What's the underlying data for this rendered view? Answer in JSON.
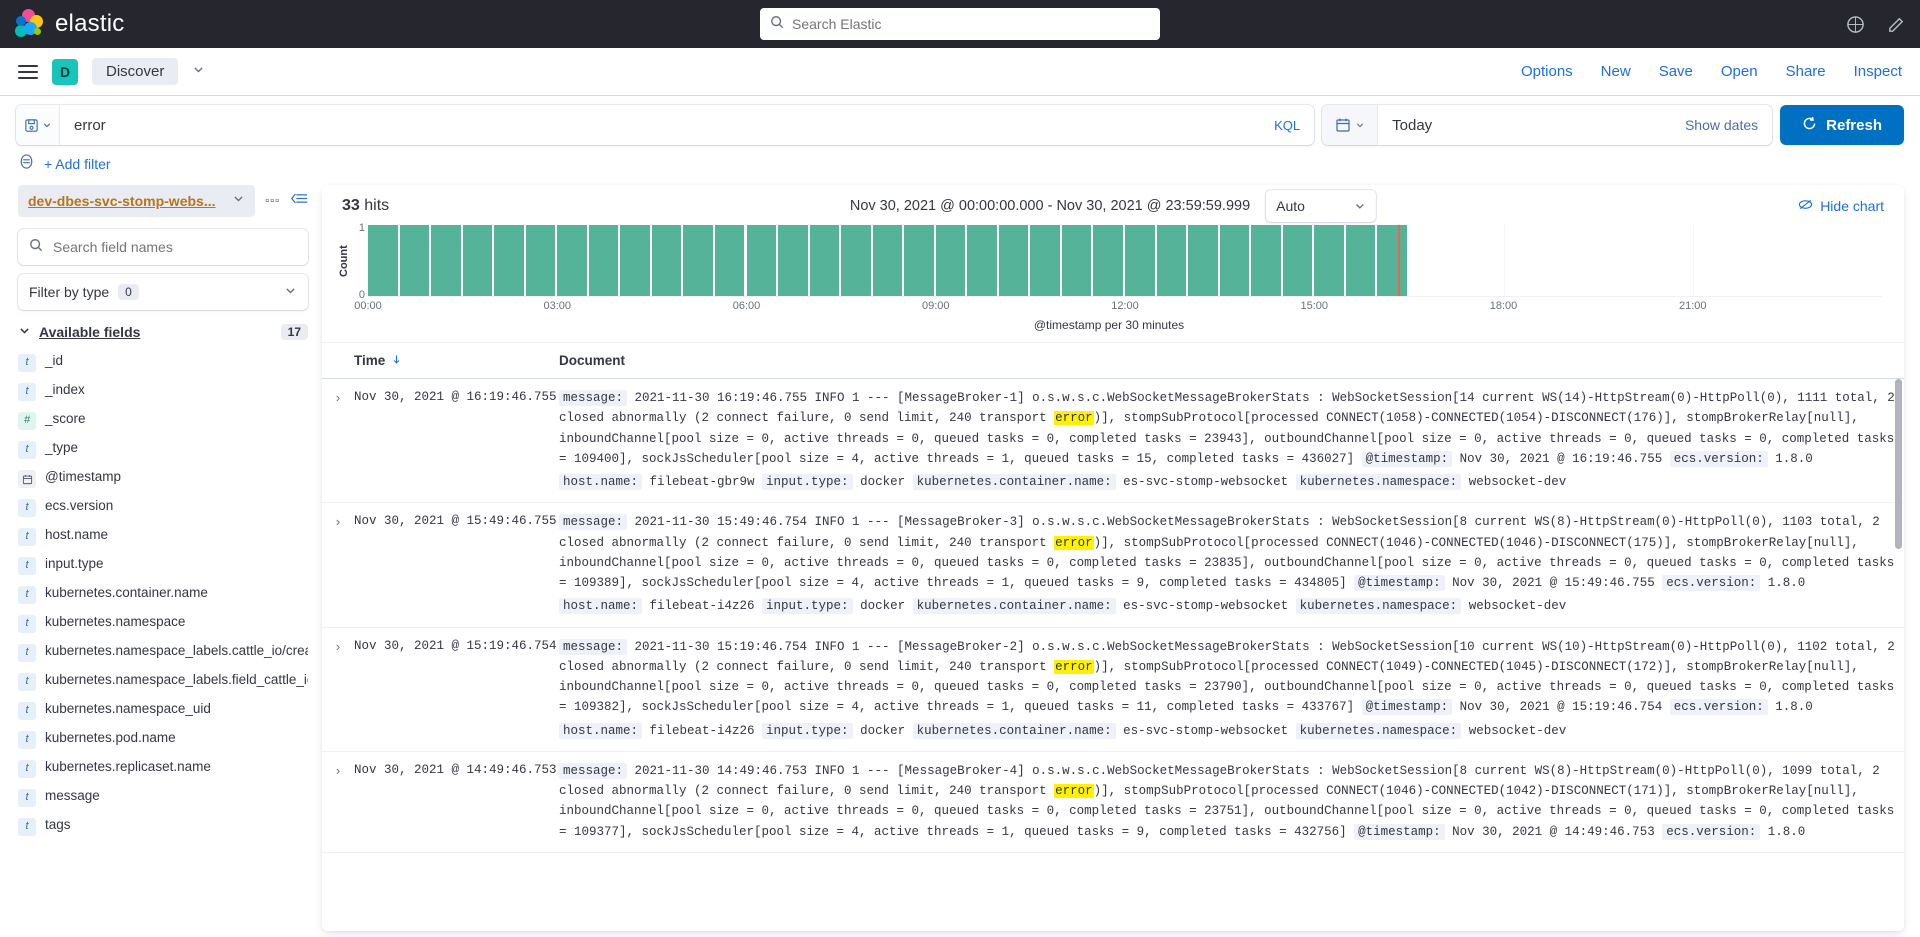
{
  "header": {
    "brand": "elastic",
    "search_placeholder": "Search Elastic",
    "icons": {
      "help": "help-icon",
      "feedback": "feedback-icon"
    }
  },
  "app_nav": {
    "menu_icon": "hamburger-menu-icon",
    "space_initial": "D",
    "breadcrumb": "Discover",
    "links": [
      "Options",
      "New",
      "Save",
      "Open",
      "Share",
      "Inspect"
    ]
  },
  "query_bar": {
    "saved_query_icon": "save-floppy-icon",
    "query": "error",
    "language": "KQL",
    "calendar_icon": "calendar-icon",
    "date_value": "Today",
    "show_dates": "Show dates",
    "refresh_label": "Refresh",
    "refresh_icon": "refresh-icon"
  },
  "filter_bar": {
    "filter_icon": "filter-icon",
    "add_filter": "+ Add filter"
  },
  "sidebar": {
    "index_pattern": "dev-dbes-svc-stomp-webs...",
    "search_placeholder": "Search field names",
    "filter_by_type": "Filter by type",
    "filter_count": "0",
    "available_fields_label": "Available fields",
    "available_fields_count": "17",
    "fields": [
      {
        "name": "_id",
        "type": "str"
      },
      {
        "name": "_index",
        "type": "str"
      },
      {
        "name": "_score",
        "type": "num"
      },
      {
        "name": "_type",
        "type": "str"
      },
      {
        "name": "@timestamp",
        "type": "date"
      },
      {
        "name": "ecs.version",
        "type": "str"
      },
      {
        "name": "host.name",
        "type": "str"
      },
      {
        "name": "input.type",
        "type": "str"
      },
      {
        "name": "kubernetes.container.name",
        "type": "str"
      },
      {
        "name": "kubernetes.namespace",
        "type": "str"
      },
      {
        "name": "kubernetes.namespace_labels.cattle_io/creator",
        "type": "str"
      },
      {
        "name": "kubernetes.namespace_labels.field_cattle_io/projectId",
        "type": "str"
      },
      {
        "name": "kubernetes.namespace_uid",
        "type": "str"
      },
      {
        "name": "kubernetes.pod.name",
        "type": "str"
      },
      {
        "name": "kubernetes.replicaset.name",
        "type": "str"
      },
      {
        "name": "message",
        "type": "str"
      },
      {
        "name": "tags",
        "type": "str"
      }
    ]
  },
  "main": {
    "hits_count": "33",
    "hits_label": "hits",
    "time_range": "Nov 30, 2021 @ 00:00:00.000 - Nov 30, 2021 @ 23:59:59.999",
    "interval": "Auto",
    "hide_chart": "Hide chart",
    "columns": {
      "time": "Time",
      "document": "Document",
      "sort_icon": "sort-desc-icon"
    }
  },
  "chart_data": {
    "type": "bar",
    "title": "",
    "xlabel": "@timestamp per 30 minutes",
    "ylabel": "Count",
    "ylim": [
      0,
      1
    ],
    "ytick_labels": [
      "0",
      "1"
    ],
    "xtick_labels": [
      "00:00",
      "03:00",
      "06:00",
      "09:00",
      "12:00",
      "15:00",
      "18:00",
      "21:00"
    ],
    "bar_color": "#54b399",
    "now_marker_color": "#e7664c",
    "now_marker_time": "16:20",
    "grid": true,
    "legend": "none",
    "bin_minutes": 30,
    "categories": [
      "00:00",
      "00:30",
      "01:00",
      "01:30",
      "02:00",
      "02:30",
      "03:00",
      "03:30",
      "04:00",
      "04:30",
      "05:00",
      "05:30",
      "06:00",
      "06:30",
      "07:00",
      "07:30",
      "08:00",
      "08:30",
      "09:00",
      "09:30",
      "10:00",
      "10:30",
      "11:00",
      "11:30",
      "12:00",
      "12:30",
      "13:00",
      "13:30",
      "14:00",
      "14:30",
      "15:00",
      "15:30",
      "16:00",
      "16:30",
      "17:00",
      "17:30",
      "18:00",
      "18:30",
      "19:00",
      "19:30",
      "20:00",
      "20:30",
      "21:00",
      "21:30",
      "22:00",
      "22:30",
      "23:00",
      "23:30"
    ],
    "values": [
      1,
      1,
      1,
      1,
      1,
      1,
      1,
      1,
      1,
      1,
      1,
      1,
      1,
      1,
      1,
      1,
      1,
      1,
      1,
      1,
      1,
      1,
      1,
      1,
      1,
      1,
      1,
      1,
      1,
      1,
      1,
      1,
      1,
      0,
      0,
      0,
      0,
      0,
      0,
      0,
      0,
      0,
      0,
      0,
      0,
      0,
      0,
      0
    ]
  },
  "documents": [
    {
      "time": "Nov 30, 2021 @ 16:19:46.755",
      "segments": [
        {
          "k": "message:"
        },
        {
          "t": " 2021-11-30 16:19:46.755 INFO 1 --- [MessageBroker-1] o.s.w.s.c.WebSocketMessageBrokerStats : WebSocketSession[14 current WS(14)-HttpStream(0)-HttpPoll(0), 1111 total, 2 closed abnormally (2 connect failure, 0 send limit, 240 transport "
        },
        {
          "hl": "error"
        },
        {
          "t": ")], stompSubProtocol[processed CONNECT(1058)-CONNECTED(1054)-DISCONNECT(176)], stompBrokerRelay[null], inboundChannel[pool size = 0, active threads = 0, queued tasks = 0, completed tasks = 23943], outboundChannel[pool size = 0, active threads = 0, queued tasks = 0, completed tasks = 109400], sockJsScheduler[pool size = 4, active threads = 1, queued tasks = 15, completed tasks = 436027] "
        },
        {
          "k": "@timestamp:"
        },
        {
          "t": " Nov 30, 2021 @ 16:19:46.755 "
        },
        {
          "k": "ecs.version:"
        },
        {
          "t": " 1.8.0"
        }
      ],
      "meta": [
        {
          "k": "host.name:",
          "v": "filebeat-gbr9w"
        },
        {
          "k": "input.type:",
          "v": "docker"
        },
        {
          "k": "kubernetes.container.name:",
          "v": "es-svc-stomp-websocket"
        },
        {
          "k": "kubernetes.namespace:",
          "v": "websocket-dev"
        }
      ]
    },
    {
      "time": "Nov 30, 2021 @ 15:49:46.755",
      "segments": [
        {
          "k": "message:"
        },
        {
          "t": " 2021-11-30 15:49:46.754 INFO 1 --- [MessageBroker-3] o.s.w.s.c.WebSocketMessageBrokerStats : WebSocketSession[8 current WS(8)-HttpStream(0)-HttpPoll(0), 1103 total, 2 closed abnormally (2 connect failure, 0 send limit, 240 transport "
        },
        {
          "hl": "error"
        },
        {
          "t": ")], stompSubProtocol[processed CONNECT(1046)-CONNECTED(1046)-DISCONNECT(175)], stompBrokerRelay[null], inboundChannel[pool size = 0, active threads = 0, queued tasks = 0, completed tasks = 23835], outboundChannel[pool size = 0, active threads = 0, queued tasks = 0, completed tasks = 109389], sockJsScheduler[pool size = 4, active threads = 1, queued tasks = 9, completed tasks = 434805] "
        },
        {
          "k": "@timestamp:"
        },
        {
          "t": " Nov 30, 2021 @ 15:49:46.755 "
        },
        {
          "k": "ecs.version:"
        },
        {
          "t": " 1.8.0"
        }
      ],
      "meta": [
        {
          "k": "host.name:",
          "v": "filebeat-i4z26"
        },
        {
          "k": "input.type:",
          "v": "docker"
        },
        {
          "k": "kubernetes.container.name:",
          "v": "es-svc-stomp-websocket"
        },
        {
          "k": "kubernetes.namespace:",
          "v": "websocket-dev"
        }
      ]
    },
    {
      "time": "Nov 30, 2021 @ 15:19:46.754",
      "segments": [
        {
          "k": "message:"
        },
        {
          "t": " 2021-11-30 15:19:46.754 INFO 1 --- [MessageBroker-2] o.s.w.s.c.WebSocketMessageBrokerStats : WebSocketSession[10 current WS(10)-HttpStream(0)-HttpPoll(0), 1102 total, 2 closed abnormally (2 connect failure, 0 send limit, 240 transport "
        },
        {
          "hl": "error"
        },
        {
          "t": ")], stompSubProtocol[processed CONNECT(1049)-CONNECTED(1045)-DISCONNECT(172)], stompBrokerRelay[null], inboundChannel[pool size = 0, active threads = 0, queued tasks = 0, completed tasks = 23790], outboundChannel[pool size = 0, active threads = 0, queued tasks = 0, completed tasks = 109382], sockJsScheduler[pool size = 4, active threads = 1, queued tasks = 11, completed tasks = 433767] "
        },
        {
          "k": "@timestamp:"
        },
        {
          "t": " Nov 30, 2021 @ 15:19:46.754 "
        },
        {
          "k": "ecs.version:"
        },
        {
          "t": " 1.8.0"
        }
      ],
      "meta": [
        {
          "k": "host.name:",
          "v": "filebeat-i4z26"
        },
        {
          "k": "input.type:",
          "v": "docker"
        },
        {
          "k": "kubernetes.container.name:",
          "v": "es-svc-stomp-websocket"
        },
        {
          "k": "kubernetes.namespace:",
          "v": "websocket-dev"
        }
      ]
    },
    {
      "time": "Nov 30, 2021 @ 14:49:46.753",
      "segments": [
        {
          "k": "message:"
        },
        {
          "t": " 2021-11-30 14:49:46.753 INFO 1 --- [MessageBroker-4] o.s.w.s.c.WebSocketMessageBrokerStats : WebSocketSession[8 current WS(8)-HttpStream(0)-HttpPoll(0), 1099 total, 2 closed abnormally (2 connect failure, 0 send limit, 240 transport "
        },
        {
          "hl": "error"
        },
        {
          "t": ")], stompSubProtocol[processed CONNECT(1046)-CONNECTED(1042)-DISCONNECT(171)], stompBrokerRelay[null], inboundChannel[pool size = 0, active threads = 0, queued tasks = 0, completed tasks = 23751], outboundChannel[pool size = 0, active threads = 0, queued tasks = 0, completed tasks = 109377], sockJsScheduler[pool size = 4, active threads = 1, queued tasks = 9, completed tasks = 432756] "
        },
        {
          "k": "@timestamp:"
        },
        {
          "t": " Nov 30, 2021 @ 14:49:46.753 "
        },
        {
          "k": "ecs.version:"
        },
        {
          "t": " 1.8.0"
        }
      ],
      "meta": []
    }
  ]
}
